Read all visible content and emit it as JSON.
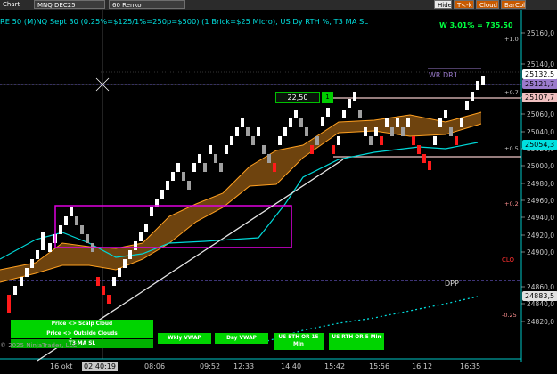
{
  "toolbar": {
    "chart_tab": "Chart",
    "instrument": "MNQ DEC25",
    "period": "60 Renko",
    "hide": "Hide",
    "tck": "T<-k",
    "cloud": "Cloud",
    "barcol": "BarCol"
  },
  "caption": "RE 50 (M)NQ Sept 30 (0.25%=$125/1%=250p=$500)  (1 Brick=$25 Micro), US Dy RTH %, T3 MA SL",
  "performance": "W 3,01% = 735,50",
  "order": {
    "qty": "22,50",
    "qty_btn": "1"
  },
  "levels": {
    "wr_dr1": "WR DR1",
    "dpp": "DPP",
    "clo": "CLO",
    "pct_10": "+1.0",
    "pct_07": "+0.7",
    "pct_05": "+0.5",
    "pct_02": "+0.2",
    "pct_m025": "-0.25"
  },
  "price_pills": {
    "p1": "25132,5",
    "p2": "25121,7",
    "p3": "25107,7",
    "p4": "25054,3",
    "p5": "24883,5"
  },
  "buttons": {
    "scalp": "Price <> Scalp Cloud",
    "outside": "Price <> Outside Clouds",
    "t3ma": "T3 MA SL",
    "wkly": "Wkly VWAP",
    "day": "Day VWAP",
    "eth": "US ETH OR 15 Min",
    "rth": "US RTH OR 5 Min"
  },
  "copyright": "© 2025 NinjaTrader, LLC",
  "cursor_time": "02:40:19",
  "colors": {
    "bull_brick": "#ffffff",
    "bear_brick": "#ff1a1a",
    "neutral_brick": "#a0a0a0",
    "cloud": "#7a4a10",
    "accent_cyan": "#00e0e0",
    "button_green": "#00d400"
  },
  "chart_data": {
    "type": "renko",
    "y_ticks": [
      "25160,0",
      "25140,0",
      "25080,0",
      "25060,0",
      "25040,0",
      "25020,0",
      "25000,0",
      "24980,0",
      "24960,0",
      "24940,0",
      "24920,0",
      "24900,0",
      "24860,0",
      "24840,0",
      "24820,0"
    ],
    "x_ticks": [
      "16 okt",
      "08:06",
      "09:52",
      "12:33",
      "14:40",
      "15:42",
      "15:56",
      "16:12",
      "16:35"
    ]
  }
}
